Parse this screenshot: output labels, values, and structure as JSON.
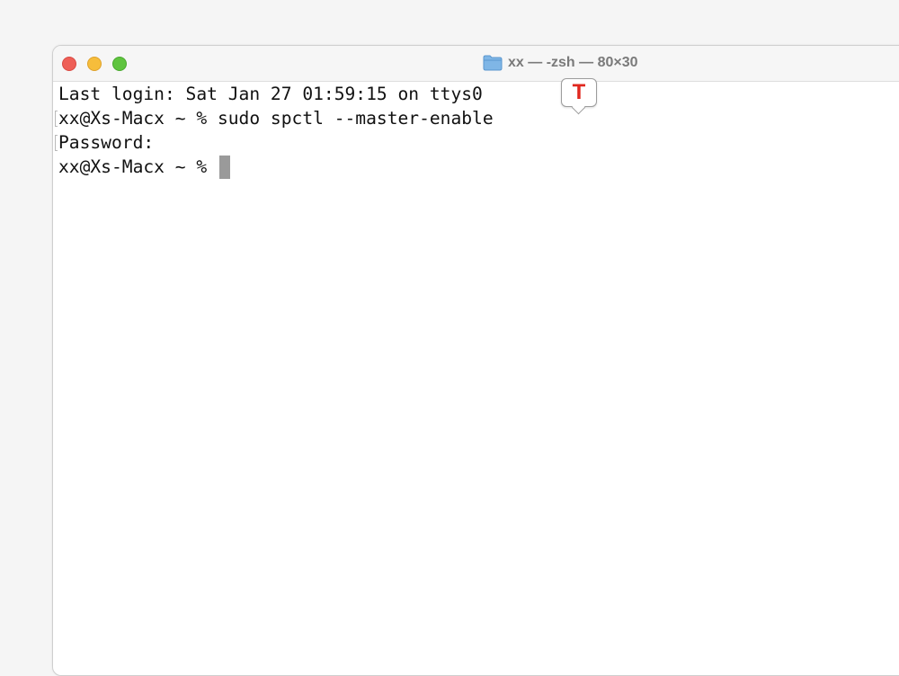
{
  "window": {
    "title": "xx — -zsh — 80×30",
    "folder_icon": "folder-icon",
    "traffic_lights": {
      "close_color": "#ee5f57",
      "minimize_color": "#f6bd3b",
      "zoom_color": "#5fc43f"
    }
  },
  "terminal": {
    "lines": [
      "Last login: Sat Jan 27 01:59:15 on ttys0",
      "xx@Xs-Macx ~ % sudo spctl --master-enable",
      "Password:",
      "xx@Xs-Macx ~ % "
    ]
  },
  "overlay_badge": {
    "letter": "T",
    "color": "#e0281f"
  }
}
